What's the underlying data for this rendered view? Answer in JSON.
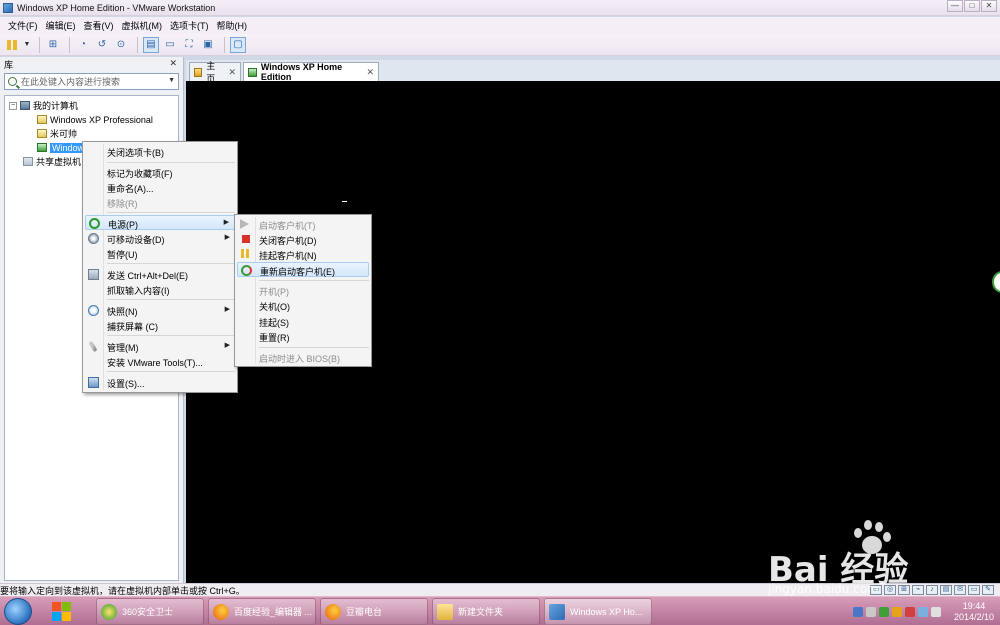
{
  "window": {
    "title": "Windows XP Home Edition - VMware Workstation",
    "minimize": "—",
    "maximize": "□",
    "close": "✕"
  },
  "menubar": [
    "文件(F)",
    "编辑(E)",
    "查看(V)",
    "虚拟机(M)",
    "选项卡(T)",
    "帮助(H)"
  ],
  "library": {
    "title": "库",
    "close": "✕",
    "search_placeholder": "在此处键入内容进行搜索",
    "tree": {
      "root": "我的计算机",
      "items": [
        "Windows XP Professional",
        "米可帅",
        "Windows XP Home Edition"
      ],
      "shared": "共享虚拟机"
    }
  },
  "tabs": [
    {
      "label": "主页",
      "close": "✕"
    },
    {
      "label": "Windows XP Home Edition",
      "close": "✕"
    }
  ],
  "context_menu": {
    "items": [
      {
        "label": "关闭选项卡(B)"
      },
      {
        "label": "标记为收藏项(F)"
      },
      {
        "label": "重命名(A)..."
      },
      {
        "label": "移除(R)"
      },
      {
        "label": "电源(P)"
      },
      {
        "label": "可移动设备(D)"
      },
      {
        "label": "暂停(U)"
      },
      {
        "label": "发送 Ctrl+Alt+Del(E)"
      },
      {
        "label": "抓取输入内容(I)"
      },
      {
        "label": "快照(N)"
      },
      {
        "label": "捕获屏幕 (C)"
      },
      {
        "label": "管理(M)"
      },
      {
        "label": "安装 VMware Tools(T)..."
      },
      {
        "label": "设置(S)..."
      }
    ],
    "arrow": "▶"
  },
  "power_submenu": {
    "items": [
      {
        "label": "启动客户机(T)"
      },
      {
        "label": "关闭客户机(D)"
      },
      {
        "label": "挂起客户机(N)"
      },
      {
        "label": "重新启动客户机(E)"
      },
      {
        "label": "开机(P)"
      },
      {
        "label": "关机(O)"
      },
      {
        "label": "挂起(S)"
      },
      {
        "label": "重置(R)"
      },
      {
        "label": "启动时进入 BIOS(B)"
      }
    ]
  },
  "statusbar": {
    "text": "要将输入定向到该虚拟机，请在虚拟机内部单击或按 Ctrl+G。"
  },
  "taskbar": {
    "tasks": [
      "360安全卫士",
      "百度经验_编辑器 ...",
      "豆瓣电台",
      "新建文件夹",
      "Windows XP Ho..."
    ],
    "clock_time": "19:44",
    "clock_date": "2014/2/10"
  },
  "watermark": {
    "brand": "Bai  经验",
    "url": "jingyan.baidu.com"
  },
  "colors": {
    "selection": "#3399ff",
    "console": "#000000",
    "taskbar": "#b06e92"
  }
}
